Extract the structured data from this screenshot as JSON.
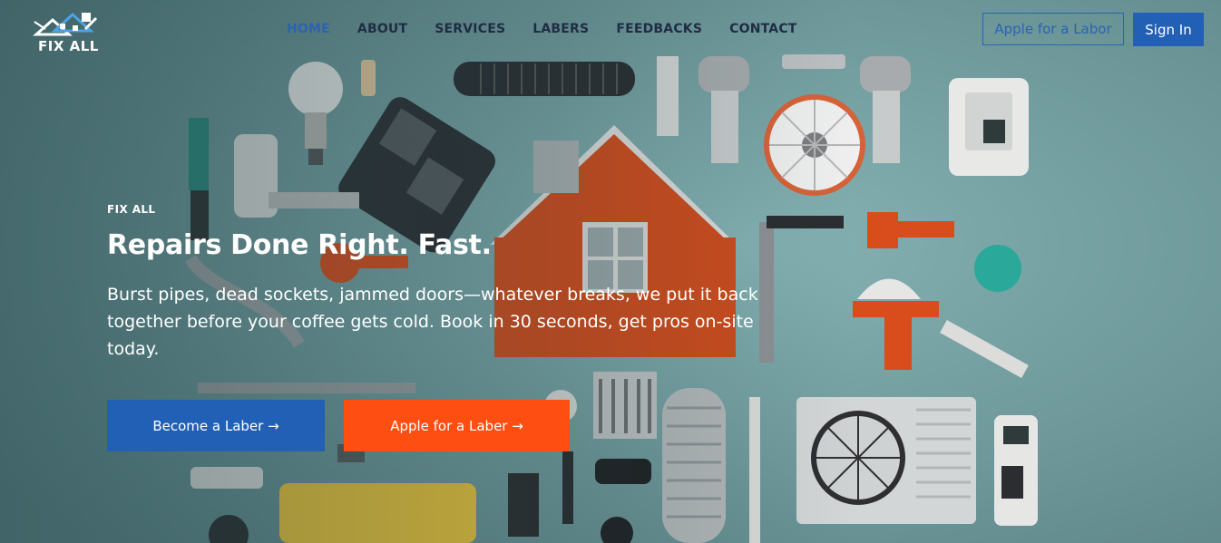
{
  "brand": {
    "name": "FIX ALL"
  },
  "nav": {
    "items": [
      {
        "label": "HOME",
        "active": true
      },
      {
        "label": "ABOUT",
        "active": false
      },
      {
        "label": "SERVICES",
        "active": false
      },
      {
        "label": "LABERS",
        "active": false
      },
      {
        "label": "FEEDBACKS",
        "active": false
      },
      {
        "label": "CONTACT",
        "active": false
      }
    ],
    "apply_label": "Apple for a Labor",
    "signin_label": "Sign In"
  },
  "hero": {
    "eyebrow": "FIX ALL",
    "headline": "Repairs Done Right. Fast.",
    "subtext": "Burst pipes, dead sockets, jammed doors—whatever breaks, we put it back together before your coffee gets cold. Book in 30 seconds, get pros on-site today.",
    "primary_cta": "Become a Laber →",
    "secondary_cta": "Apple for a Laber →"
  },
  "colors": {
    "primary": "#2160b5",
    "accent": "#ff4e12",
    "nav_text": "#1f2d44",
    "background": "#6f9599"
  }
}
